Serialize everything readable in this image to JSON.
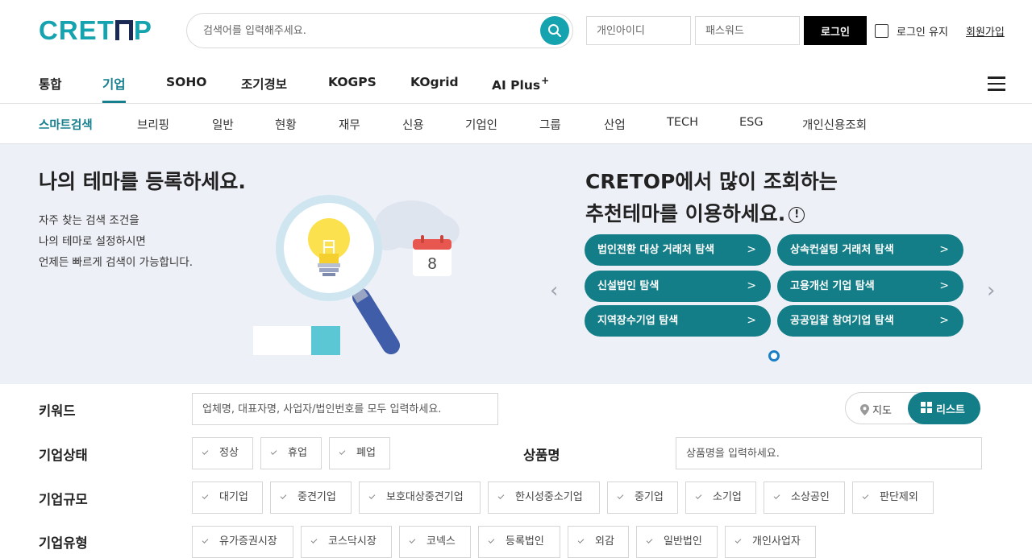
{
  "header": {
    "logo_text_pre": "CRET",
    "logo_text_post": "P",
    "search_placeholder": "검색어를 입력해주세요.",
    "id_placeholder": "개인아이디",
    "pw_placeholder": "패스워드",
    "login_label": "로그인",
    "keep_login_label": "로그인 유지",
    "join_label": "회원가입"
  },
  "main_nav": [
    {
      "label": "통합"
    },
    {
      "label": "기업",
      "active": true
    },
    {
      "label": "SOHO"
    },
    {
      "label": "조기경보"
    },
    {
      "label": "KOGPS"
    },
    {
      "label": "KOgrid"
    },
    {
      "label": "AI Plus",
      "sup": "+"
    }
  ],
  "sub_nav": [
    {
      "label": "스마트검색",
      "active": true
    },
    {
      "label": "브리핑"
    },
    {
      "label": "일반"
    },
    {
      "label": "현황"
    },
    {
      "label": "재무"
    },
    {
      "label": "신용"
    },
    {
      "label": "기업인"
    },
    {
      "label": "그룹"
    },
    {
      "label": "산업"
    },
    {
      "label": "TECH"
    },
    {
      "label": "ESG"
    },
    {
      "label": "개인신용조회"
    }
  ],
  "banner": {
    "left_title": "나의 테마를 등록하세요.",
    "left_desc": [
      "자주 찾는 검색 조건을",
      "나의 테마로 설정하시면",
      "언제든 빠르게 검색이 가능합니다."
    ],
    "calendar_number": "8",
    "right_title_1": "CRETOP에서 많이 조회하는",
    "right_title_2": "추천테마를 이용하세요.",
    "info_symbol": "!",
    "themes": [
      {
        "label": "법인전환 대상 거래처 탐색"
      },
      {
        "label": "상속컨설팅 거래처 탐색"
      },
      {
        "label": "신설법인 탐색"
      },
      {
        "label": "고용개선 기업 탐색"
      },
      {
        "label": "지역장수기업 탐색"
      },
      {
        "label": "공공입찰 참여기업 탐색"
      }
    ],
    "colors": {
      "accent": "#137e88",
      "bg": "#eef0f7"
    }
  },
  "filters": {
    "keyword_label": "키워드",
    "keyword_placeholder": "업체명, 대표자명, 사업자/법인번호를 모두 입력하세요.",
    "view_map_label": "지도",
    "view_list_label": "리스트",
    "status_label": "기업상태",
    "status_options": [
      "정상",
      "휴업",
      "폐업"
    ],
    "product_label": "상품명",
    "product_placeholder": "상품명을 입력하세요.",
    "scale_label": "기업규모",
    "scale_options": [
      "대기업",
      "중견기업",
      "보호대상중견기업",
      "한시성중소기업",
      "중기업",
      "소기업",
      "소상공인",
      "판단제외"
    ],
    "type_label": "기업유형",
    "type_options": [
      "유가증권시장",
      "코스닥시장",
      "코넥스",
      "등록법인",
      "외감",
      "일반법인",
      "개인사업자"
    ]
  }
}
